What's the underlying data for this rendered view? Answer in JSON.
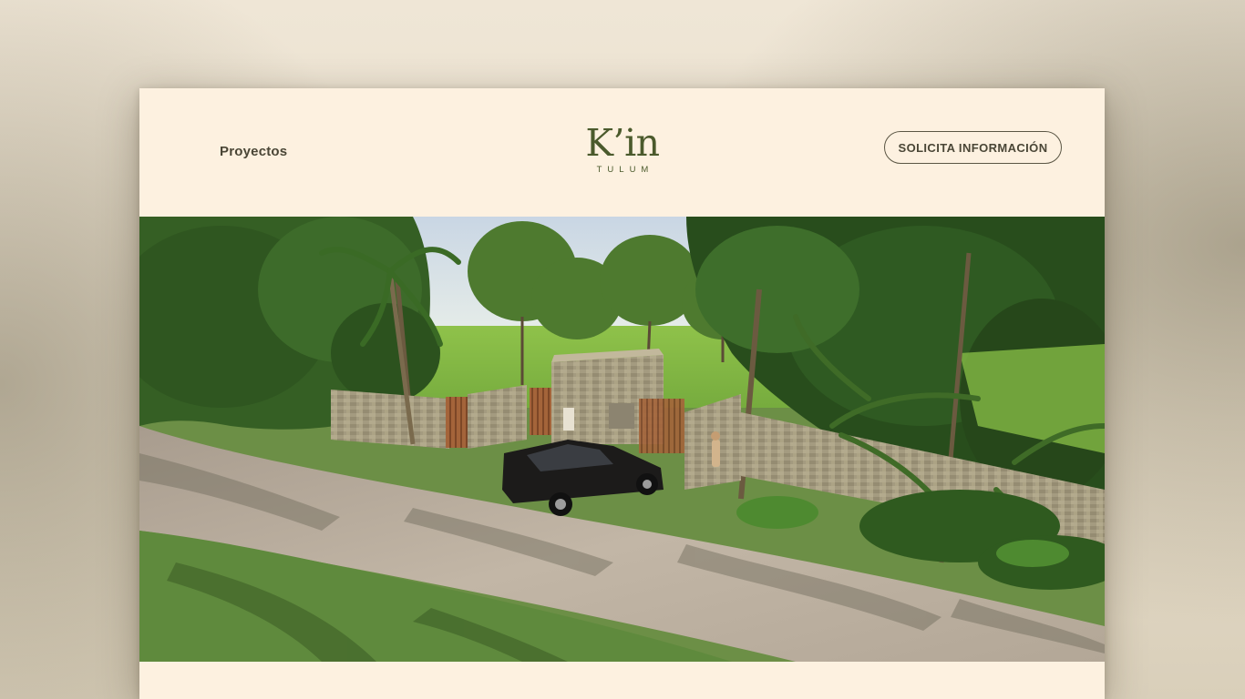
{
  "header": {
    "nav_link": "Proyectos",
    "logo_name": "K’in",
    "logo_sub": "TULUM",
    "cta_label": "SOLICITA INFORMACIÓN"
  },
  "hero": {
    "scene": "rendering of stone gated entrance with car on gravel road among tropical trees"
  },
  "colors": {
    "page_background": "#fdf1e0",
    "brand_green": "#4b5a2c",
    "text_dark": "#4a4636"
  }
}
